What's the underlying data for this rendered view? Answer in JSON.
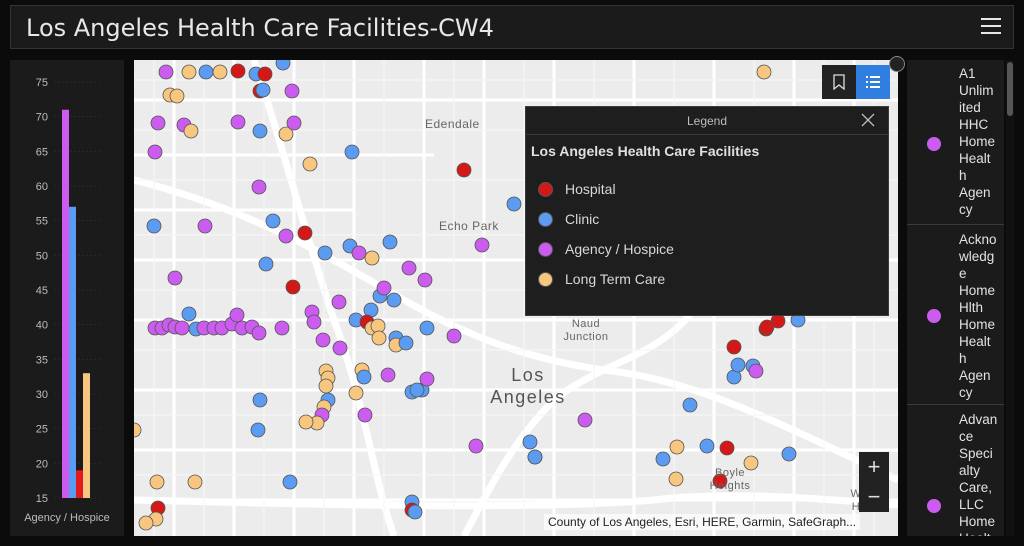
{
  "header": {
    "title": "Los Angeles Health Care Facilities-CW4"
  },
  "icons": {
    "menu": "hamburger-menu-icon",
    "bookmark": "bookmark-icon",
    "legend": "legend-list-icon",
    "close": "close-icon",
    "expand": "expand-icon",
    "zoom_in": "plus-icon",
    "zoom_out": "minus-icon"
  },
  "chart_data": {
    "type": "bar",
    "xlabel": "Agency / Hospice",
    "ylim": [
      15,
      75
    ],
    "yticks": [
      15,
      20,
      25,
      30,
      35,
      40,
      45,
      50,
      55,
      60,
      65,
      70,
      75
    ],
    "categories": [
      "Agency / Hospice",
      "Clinic",
      "Hospital",
      "Long Term Care"
    ],
    "values": [
      71,
      57,
      19,
      33
    ],
    "colors": [
      "#cc5cf0",
      "#5b9bf2",
      "#e11b1b",
      "#f7c77f"
    ]
  },
  "map": {
    "places": {
      "edendale": "Edendale",
      "echo_park": "Echo Park",
      "naud_junction_1": "Naud",
      "naud_junction_2": "Junction",
      "los_angeles_1": "Los",
      "los_angeles_2": "Angeles",
      "boyle_1": "Boyle",
      "boyle_2": "Heights",
      "edge_1": "W",
      "edge_2": "H"
    },
    "attribution": "County of Los Angeles, Esri, HERE, Garmin, SafeGraph...",
    "zoom_in": "+",
    "zoom_out": "−"
  },
  "legend": {
    "title": "Legend",
    "layer_title": "Los Angeles Health Care Facilities",
    "items": [
      {
        "label": "Hospital",
        "color": "#d41818"
      },
      {
        "label": "Clinic",
        "color": "#5b9bf2"
      },
      {
        "label": "Agency / Hospice",
        "color": "#cc5cf0"
      },
      {
        "label": "Long Term Care",
        "color": "#f7c77f"
      }
    ]
  },
  "list": {
    "items": [
      {
        "name": "A1 Unlimited HHC Home Health Agency",
        "lines": [
          "A1",
          "Unlim",
          "ited",
          "HHC",
          "Home",
          "Healt",
          "h",
          "Agen",
          "cy"
        ],
        "color": "#cc5cf0"
      },
      {
        "name": "Acknowledge Home Hlth Home Health Agency",
        "lines": [
          "Ackno",
          "wledg",
          "e",
          "Home",
          "Hlth",
          "Home",
          "Healt",
          "h",
          "Agen",
          "cy"
        ],
        "color": "#cc5cf0"
      },
      {
        "name": "Advance Specialty Care, LLC Home Health",
        "lines": [
          "Advan",
          "ce",
          "Speci",
          "alty",
          "Care,",
          "LLC",
          "Home",
          "Healt"
        ],
        "color": "#cc5cf0"
      }
    ]
  }
}
